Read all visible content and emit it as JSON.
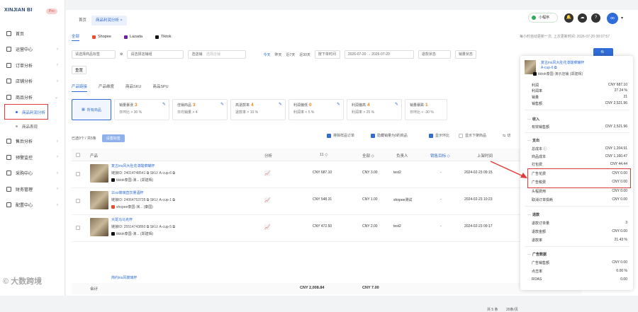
{
  "sidebar": {
    "logo": "XINJIAN BI",
    "pro": "Pro",
    "items": [
      {
        "label": "首页",
        "icon": "home-icon"
      },
      {
        "label": "运营中心",
        "icon": "grid-icon",
        "has_arrow": true
      },
      {
        "label": "订单分析",
        "icon": "order-icon",
        "has_arrow": true
      },
      {
        "label": "店铺分析",
        "icon": "store-icon",
        "has_arrow": true
      },
      {
        "label": "商品分析",
        "icon": "goods-icon",
        "has_arrow": true
      }
    ],
    "sub_items": [
      {
        "label": "商品利润分析",
        "active": true
      },
      {
        "label": "商品表现",
        "active": false
      }
    ],
    "items2": [
      {
        "label": "售后分析",
        "icon": "aftersale-icon"
      },
      {
        "label": "预警监控",
        "icon": "alert-icon"
      },
      {
        "label": "采购中心",
        "icon": "purchase-icon"
      },
      {
        "label": "财务管理",
        "icon": "finance-icon"
      },
      {
        "label": "配置中心",
        "icon": "config-icon"
      }
    ]
  },
  "header": {
    "tabs": [
      "首页",
      "商品利润分析 ×"
    ],
    "mini_program": "小程序",
    "avatar": "oo"
  },
  "platforms": {
    "all": "全部",
    "shopee": "Shopee",
    "lazada": "Lazada",
    "tiktok": "Tiktok",
    "refresh": "每小时自动更新一次, 上次更新时间: 2026-07-20 08:07:57"
  },
  "filters": {
    "product_type": "请选择商品标签",
    "shop": "请选择店铺组",
    "store": "选店铺",
    "store_ph": "选择店铺",
    "today": "今天",
    "yesterday": "昨天",
    "last7": "近7天",
    "last30": "近30天",
    "order_time": "按下单时间",
    "date_from": "2026-07-20",
    "date_to": "2026-07-20",
    "return_status": "退款状态",
    "sales_status": "销量状态",
    "search": "🔍"
  },
  "reset": "重置",
  "subtabs": [
    "产品链接",
    "产品维度",
    "商品SKU",
    "商品SPU"
  ],
  "cards": {
    "all": "所有商品",
    "list": [
      {
        "label": "销量暴涨",
        "num": "3",
        "sub": "日环比 > 30 %"
      },
      {
        "label": "佳销商品",
        "num": "3",
        "sub": "日均销量 > 4"
      },
      {
        "label": "高退款率",
        "num": "4",
        "sub": "退款率 > 10 %"
      },
      {
        "label": "利润偏低",
        "num": "0",
        "sub": "利润率 < 5 %"
      },
      {
        "label": "利润偏高",
        "num": "4",
        "sub": "利润率 > 25 %"
      },
      {
        "label": "销量暴跌",
        "num": "1",
        "sub": "日环比 < -30 %"
      }
    ]
  },
  "listbar": {
    "selected": "已选0个 / 共5条",
    "set_btn": "设置标签",
    "cb1": "排除样品订单",
    "cb2": "隐藏销量为0的商品",
    "cb3": "显示环比",
    "cb4": "显示下架商品",
    "cb5": "切"
  },
  "table": {
    "headers": [
      "产品",
      "分析",
      "11 ◇",
      "全部 ◇",
      "负责人",
      "销售目标 ◇",
      "上架时间"
    ],
    "rows": [
      {
        "name": "复古ins风大肚花漆酸菜罐杯",
        "id": "链接ID: 24014748541 ⧉  SKU: A-cup-6 ⧉",
        "shop": "tiktok泰国-演... (郑建辉)",
        "shopcolor": "#111",
        "profit": "CNY 687.10",
        "cost": "CNY 3.00",
        "owner": "test2",
        "target": "-",
        "date": "2024-02-23 09:15"
      },
      {
        "name": "11oz玻璃直饮量酒杯",
        "id": "链接ID: 24064753735 ⧉  SKU: A-cup-1 ⧉",
        "shop": "shopee泰国-演... (秦国)",
        "shopcolor": "#ee4d2d",
        "profit": "CNY 548.31",
        "cost": "CNY 1.00",
        "owner": "shopee测试",
        "target": "-",
        "date": "2024-02-23 10:23"
      },
      {
        "name": "大斑马马克杯",
        "id": "链接ID: 25514743860 ⧉  SKU: A-cup-5 ⧉",
        "shop": "tiktok泰国-演... (郑建辉)",
        "shopcolor": "#111",
        "profit": "CNY 472.50",
        "cost": "CNY 2.00",
        "owner": "test2",
        "target": "-",
        "date": "2024-02-23 09:17"
      }
    ],
    "partial": "简约ins风玻璃杯",
    "total_label": "合计",
    "total_profit": "CNY 2,008.84",
    "total_cost": "CNY 7.00"
  },
  "pager": {
    "total": "共 5 条",
    "size": "20条/页"
  },
  "popup": {
    "name": "复古ins风大肚花漆酸菜罐杯",
    "sku": "A-cup-6 ⧉",
    "shop": "tiktok泰国-演示店铺 (郑建辉)",
    "rows1": [
      [
        "利润",
        "CNY 687.10"
      ],
      [
        "利润率",
        "27.24 %"
      ],
      [
        "销量",
        "21"
      ],
      [
        "销售额",
        "CNY 2,521.96"
      ]
    ],
    "sec_income": "收入",
    "income": [
      [
        "有效销售额",
        "CNY 2,521.96"
      ]
    ],
    "sec_expense": "支出",
    "expense": [
      [
        "总成本 ⓘ",
        "CNY 1,204.91"
      ],
      [
        "商品成本",
        "CNY 1,160.47"
      ],
      [
        "打包费",
        "CNY 44.44"
      ],
      [
        "广告花费",
        "CNY 0.00"
      ],
      [
        "广告税费",
        "CNY 0.00"
      ],
      [
        "头程费用",
        "CNY 0.00"
      ],
      [
        "取消订单损耗",
        "CNY 0.00"
      ]
    ],
    "sec_refund": "退款",
    "refund": [
      [
        "退款订单量",
        "3"
      ],
      [
        "退款金额",
        "CNY 0.00"
      ],
      [
        "退款率",
        "21.43 %"
      ]
    ],
    "sec_ad": "广告数据",
    "ad": [
      [
        "广告销售额",
        "CNY 0.00"
      ],
      [
        "点击率",
        "0.00 %"
      ],
      [
        "ROAS",
        "0.00"
      ]
    ]
  },
  "watermark": "© 大数跨境"
}
